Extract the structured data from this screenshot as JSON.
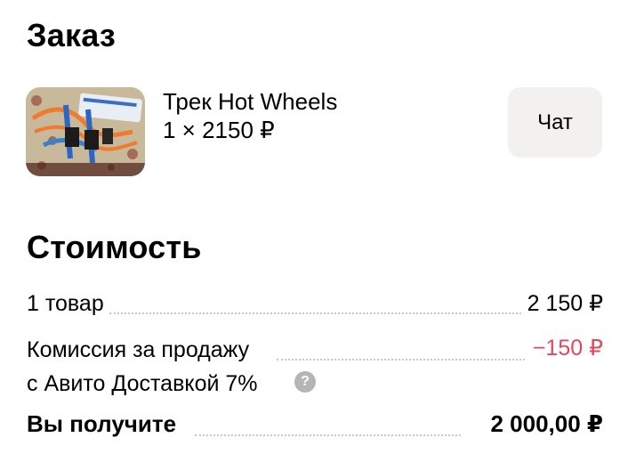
{
  "order": {
    "title": "Заказ",
    "item": {
      "name": "Трек Hot Wheels",
      "quantity_price": "1 × 2150 ₽",
      "image_icon": "toy-track-photo"
    },
    "chat_button": "Чат"
  },
  "cost": {
    "title": "Стоимость",
    "rows": [
      {
        "label": "1 товар",
        "value": "2 150 ₽"
      },
      {
        "label_line1": "Комиссия за продажу",
        "label_line2": "с Авито Доставкой 7%",
        "value": "−150 ₽",
        "help_icon": "?"
      },
      {
        "label": "Вы получите",
        "value": "2 000,00 ₽"
      }
    ]
  },
  "colors": {
    "negative": "#e4485a",
    "chat_bg": "#f2f1f0",
    "help_icon_bg": "#b5b5b5"
  }
}
